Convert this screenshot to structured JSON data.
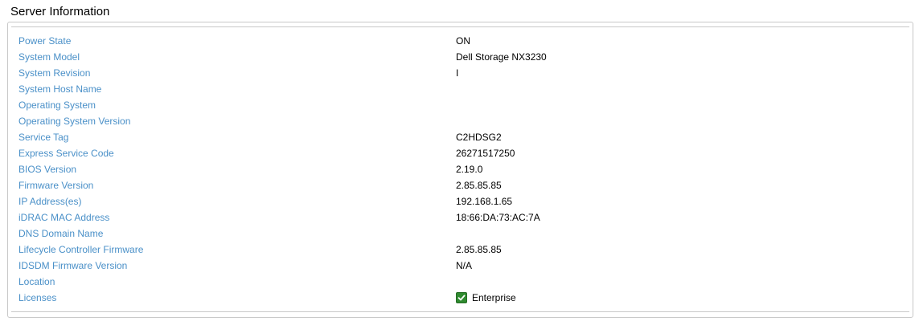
{
  "section": {
    "title": "Server Information"
  },
  "rows": [
    {
      "label": "Power State",
      "value": "ON"
    },
    {
      "label": "System Model",
      "value": "Dell Storage NX3230"
    },
    {
      "label": "System Revision",
      "value": "I"
    },
    {
      "label": "System Host Name",
      "value": ""
    },
    {
      "label": "Operating System",
      "value": ""
    },
    {
      "label": "Operating System Version",
      "value": ""
    },
    {
      "label": "Service Tag",
      "value": "C2HDSG2"
    },
    {
      "label": "Express Service Code",
      "value": "26271517250"
    },
    {
      "label": "BIOS Version",
      "value": "2.19.0"
    },
    {
      "label": "Firmware Version",
      "value": "2.85.85.85"
    },
    {
      "label": "IP Address(es)",
      "value": "192.168.1.65"
    },
    {
      "label": "iDRAC MAC Address",
      "value": "18:66:DA:73:AC:7A"
    },
    {
      "label": "DNS Domain Name",
      "value": ""
    },
    {
      "label": "Lifecycle Controller Firmware",
      "value": "2.85.85.85"
    },
    {
      "label": "IDSDM Firmware Version",
      "value": "N/A"
    },
    {
      "label": "Location",
      "value": ""
    },
    {
      "label": "Licenses",
      "value": "Enterprise",
      "icon": "checkmark-icon"
    }
  ],
  "colors": {
    "label": "#4a90c8",
    "value": "#000000",
    "border": "#c8c8c8",
    "check_bg": "#2f8a2f"
  }
}
